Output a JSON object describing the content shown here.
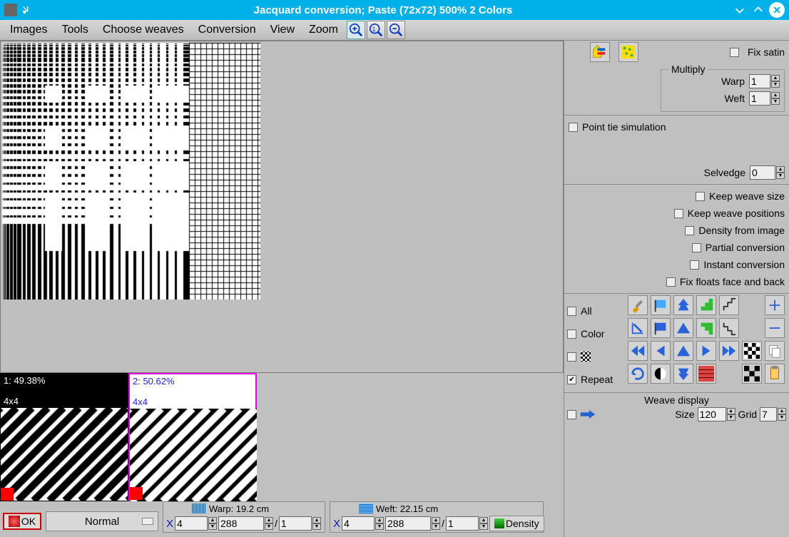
{
  "title": "Jacquard conversion; Paste (72x72) 500% 2 Colors",
  "menu": {
    "images": "Images",
    "tools": "Tools",
    "choose": "Choose weaves",
    "conversion": "Conversion",
    "view": "View",
    "zoom": "Zoom"
  },
  "swatches": {
    "s1": {
      "line1": "1: 49.38%",
      "line2": "4x4"
    },
    "s2": {
      "line1": "2: 50.62%",
      "line2": "4x4"
    }
  },
  "bottom": {
    "ok": "OK",
    "normal": "Normal",
    "warp": {
      "label": "Warp: 19.2 cm",
      "x": "4",
      "total": "288",
      "of": "1",
      "sep": "/"
    },
    "weft": {
      "label": "Weft: 22.15 cm",
      "x": "4",
      "total": "288",
      "of": "1",
      "sep": "/"
    },
    "density": "Density",
    "xlabel": "X"
  },
  "panel": {
    "fix_satin": "Fix satin",
    "multiply": {
      "legend": "Multiply",
      "warp_l": "Warp",
      "warp_v": "1",
      "weft_l": "Weft",
      "weft_v": "1"
    },
    "point_tie": "Point tie simulation",
    "selvedge_l": "Selvedge",
    "selvedge_v": "0",
    "keep_size": "Keep weave size",
    "keep_pos": "Keep weave positions",
    "dens_img": "Density from image",
    "partial": "Partial conversion",
    "instant": "Instant conversion",
    "fix_floats": "Fix floats face and back",
    "all": "All",
    "color": "Color",
    "repeat": "Repeat",
    "wd": {
      "title": "Weave display",
      "size_l": "Size",
      "size_v": "120",
      "grid_l": "Grid",
      "grid_v": "7"
    }
  }
}
